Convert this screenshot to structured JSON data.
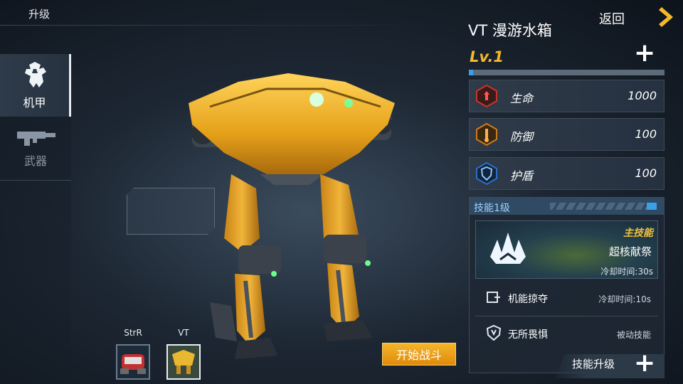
{
  "header": {
    "title": "升级"
  },
  "nav": {
    "items": [
      {
        "label": "机甲",
        "icon": "mech-icon",
        "active": true
      },
      {
        "label": "武器",
        "icon": "weapon-icon",
        "active": false
      }
    ]
  },
  "robots": [
    {
      "label": "StrR",
      "active": false
    },
    {
      "label": "VT",
      "active": true
    }
  ],
  "start_button": "开始战斗",
  "back_label": "返回",
  "robot": {
    "name": "VT 漫游水箱",
    "level": "Lv.1",
    "xp_progress": 0.02
  },
  "stats": [
    {
      "name": "生命",
      "value": "1000",
      "icon": "health-icon",
      "color": "#c8352b"
    },
    {
      "name": "防御",
      "value": "100",
      "icon": "defense-icon",
      "color": "#d07a1a"
    },
    {
      "name": "护盾",
      "value": "100",
      "icon": "shield-icon",
      "color": "#2b6fc8"
    }
  ],
  "skills": {
    "header": "技能1级",
    "main": {
      "tag": "主技能",
      "name": "超核献祭",
      "cooldown": "冷却时间:30s"
    },
    "list": [
      {
        "name": "机能掠夺",
        "note": "冷却时间:10s",
        "icon": "plunder-icon"
      },
      {
        "name": "无所畏惧",
        "note": "被动技能",
        "icon": "fearless-icon"
      }
    ],
    "upgrade_label": "技能升级"
  },
  "colors": {
    "accent": "#f4b82a",
    "xp": "#3aa0e8",
    "start": "#f0a21c"
  }
}
